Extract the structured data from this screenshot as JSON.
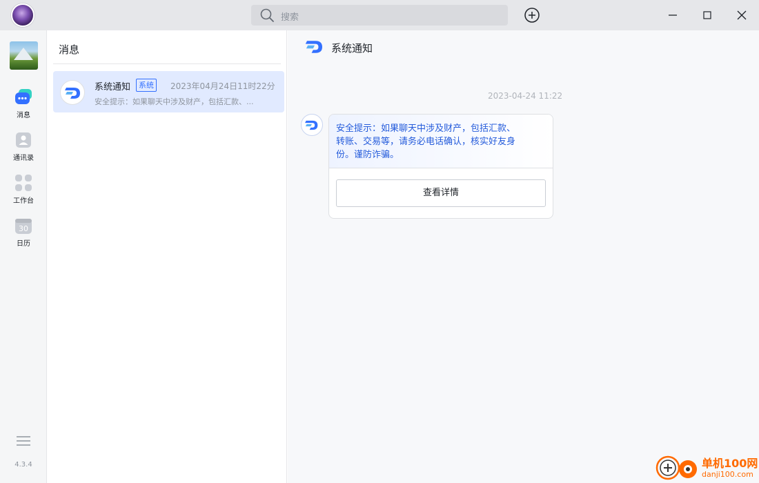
{
  "titlebar": {
    "search_placeholder": "搜索",
    "icons": [
      "user-avatar",
      "search-icon",
      "add-icon",
      "minimize-icon",
      "maximize-icon",
      "close-icon"
    ]
  },
  "nav": {
    "items": [
      {
        "label": "消息",
        "icon": "chat-bubble-icon",
        "active": true
      },
      {
        "label": "通讯录",
        "icon": "contacts-icon",
        "active": false
      },
      {
        "label": "工作台",
        "icon": "workbench-icon",
        "active": false
      },
      {
        "label": "日历",
        "icon": "calendar-icon",
        "active": false,
        "icon_text": "30"
      }
    ],
    "version": "4.3.4"
  },
  "conversations": {
    "title": "消息",
    "items": [
      {
        "name": "系统通知",
        "tag": "系统",
        "time": "2023年04月24日11时22分",
        "preview": "安全提示：如果聊天中涉及财产，包括汇款、..."
      }
    ]
  },
  "chat": {
    "title": "系统通知",
    "timestamp": "2023-04-24 11:22",
    "message": {
      "text": "安全提示：如果聊天中涉及财产，包括汇款、转账、交易等，请务必电话确认，核实好友身份。谨防诈骗。",
      "button_label": "查看详情"
    }
  },
  "watermark": {
    "title": "单机100网",
    "url": "danji100.com"
  },
  "colors": {
    "accent": "#3370ff",
    "active_item_bg": "#e1eaff",
    "watermark": "#ff6a00"
  }
}
